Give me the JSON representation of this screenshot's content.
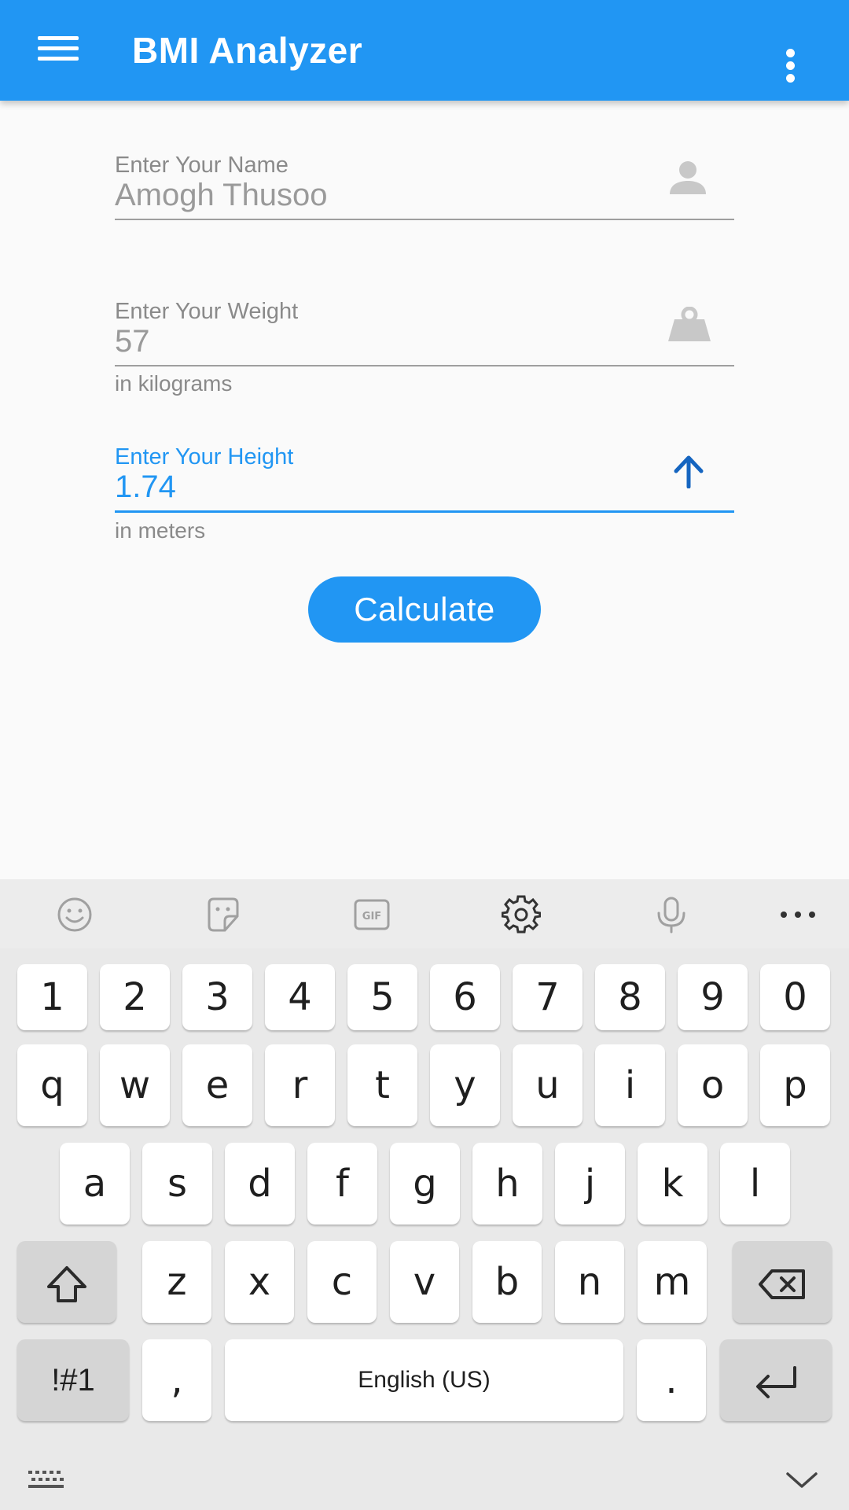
{
  "app_bar": {
    "title": "BMI Analyzer",
    "color": "#2196F3",
    "menu_icon": "hamburger-menu-icon",
    "overflow_icon": "more-vertical-icon"
  },
  "form": {
    "name_field": {
      "label": "Enter Your Name",
      "value": "Amogh Thusoo",
      "icon": "person-icon"
    },
    "weight_field": {
      "label": "Enter Your Weight",
      "value": "57",
      "helper": "in kilograms",
      "icon": "weight-icon"
    },
    "height_field": {
      "label": "Enter Your Height",
      "value": "1.74",
      "helper": "in meters",
      "icon": "arrow-up-icon",
      "focused": true
    },
    "calculate_label": "Calculate"
  },
  "keyboard": {
    "toolbar_icons": [
      "emoji-icon",
      "sticker-icon",
      "gif-icon",
      "settings-icon",
      "microphone-icon",
      "more-horizontal-icon"
    ],
    "number_row": [
      "1",
      "2",
      "3",
      "4",
      "5",
      "6",
      "7",
      "8",
      "9",
      "0"
    ],
    "row1": [
      "q",
      "w",
      "e",
      "r",
      "t",
      "y",
      "u",
      "i",
      "o",
      "p"
    ],
    "row2": [
      "a",
      "s",
      "d",
      "f",
      "g",
      "h",
      "j",
      "k",
      "l"
    ],
    "row3": [
      "z",
      "x",
      "c",
      "v",
      "b",
      "n",
      "m"
    ],
    "symbols_label": "!#1",
    "comma": ",",
    "space_label": "English (US)",
    "period": "."
  }
}
